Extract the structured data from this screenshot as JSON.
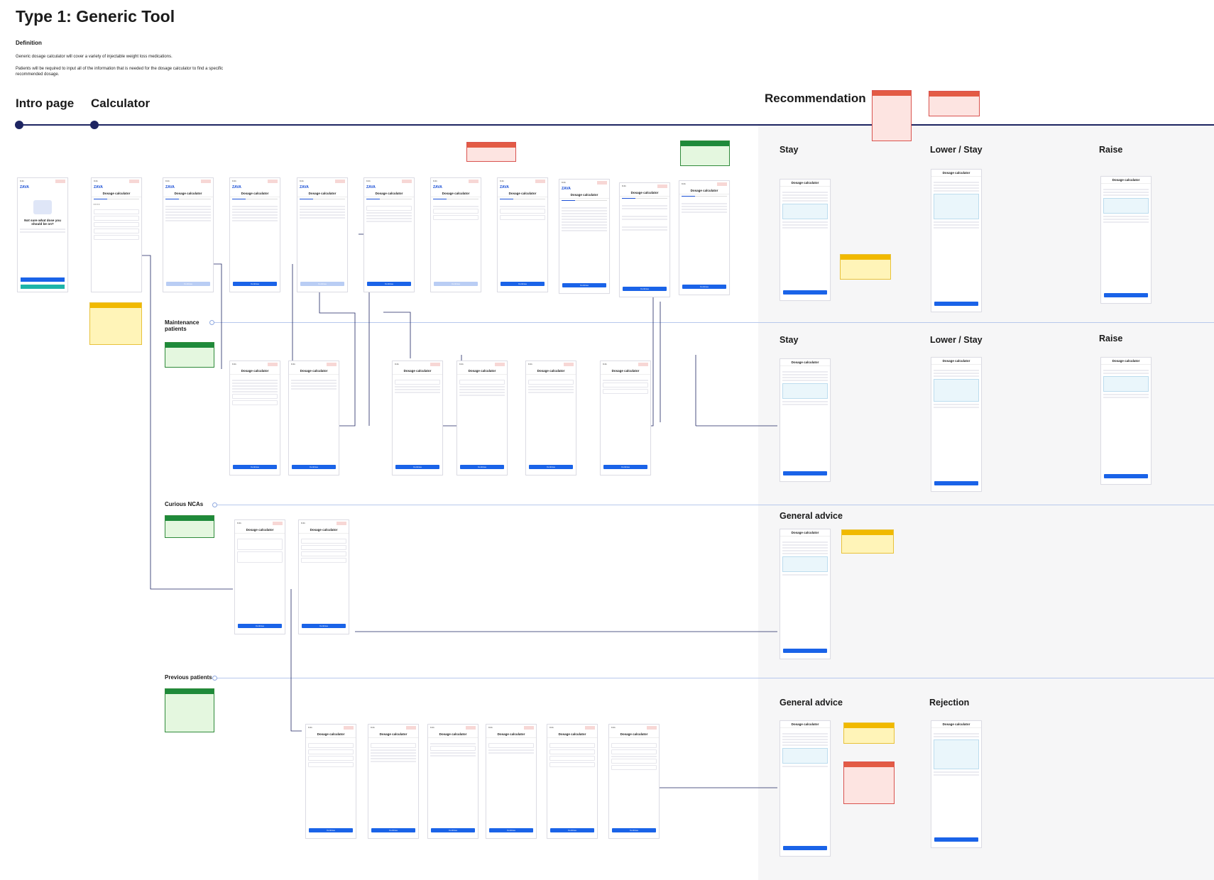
{
  "page": {
    "title": "Type 1: Generic Tool",
    "definition_heading": "Definition",
    "definition_p1": "Generic dosage calculator will cover a variety of injectable weight loss medications.",
    "definition_p2": "Patients will be required to input all of the information that is needed for the dosage calculator to find a specific recommended dosage."
  },
  "sections": {
    "intro": "Intro page",
    "calculator": "Calculator",
    "recommendation": "Recommendation"
  },
  "outcomes": {
    "row1": [
      "Stay",
      "Lower / Stay",
      "Raise"
    ],
    "row2": [
      "Stay",
      "Lower / Stay",
      "Raise"
    ],
    "row3": [
      "General advice"
    ],
    "row4": [
      "General advice",
      "Rejection"
    ]
  },
  "lanes": {
    "maintenance": "Maintenance patients",
    "curious": "Curious NCAs",
    "previous": "Previous patients"
  },
  "screen": {
    "brand": "ZAVA",
    "header": "Dosage calculator",
    "button": "Continue",
    "intro_heading": "Not sure what dose you should be on?"
  },
  "colors": {
    "timeline": "#1e2562",
    "primary": "#1a63e8",
    "note_yellow": "#fff4b8",
    "note_green": "#e4f7df",
    "note_red": "#fde4e1"
  }
}
